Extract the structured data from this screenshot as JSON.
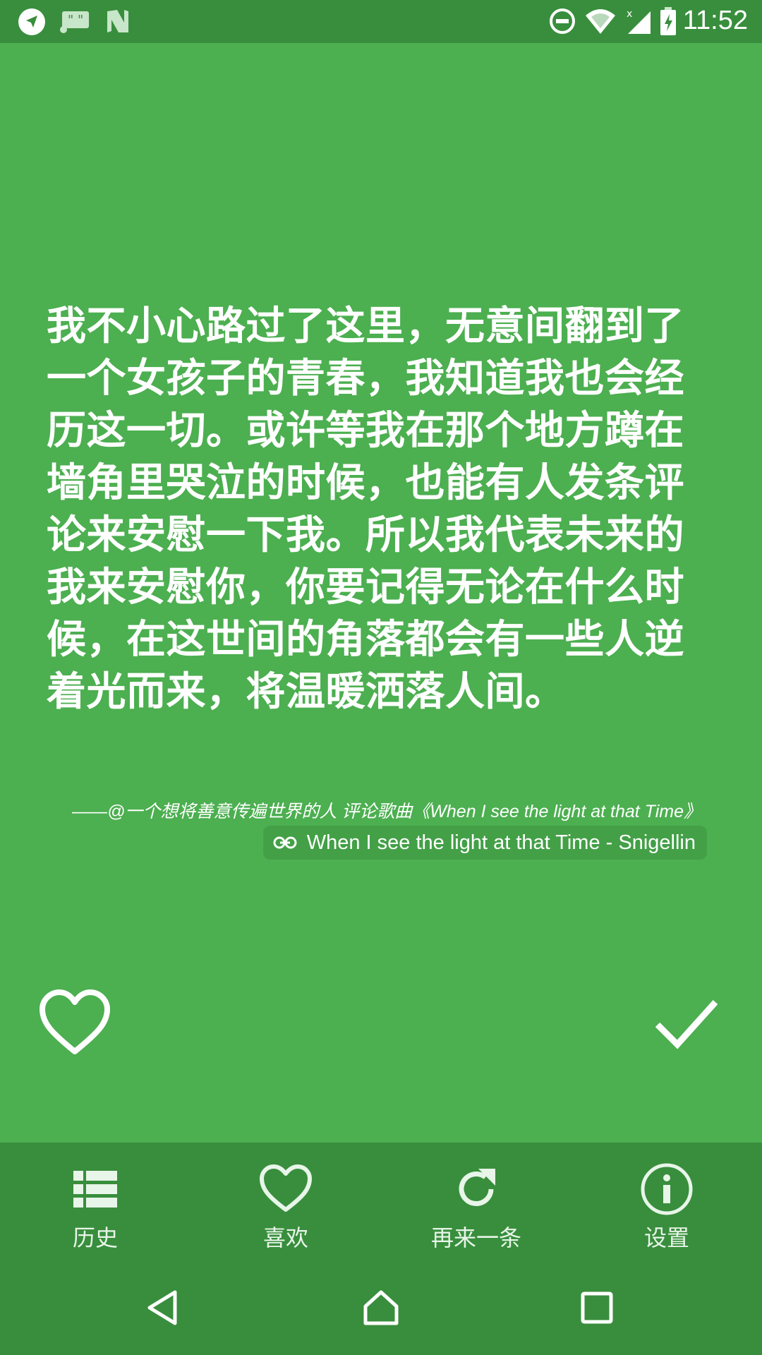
{
  "status_bar": {
    "time": "11:52",
    "left_icons": [
      "navigation-arrow-icon",
      "quote-keyboard-icon",
      "n-logo-icon"
    ],
    "right_icons": [
      "do-not-disturb-icon",
      "wifi-icon",
      "cellular-signal-icon",
      "battery-charging-icon"
    ]
  },
  "quote": {
    "text": "我不小心路过了这里，无意间翻到了一个女孩子的青春，我知道我也会经历这一切。或许等我在那个地方蹲在墙角里哭泣的时候，也能有人发条评论来安慰一下我。所以我代表未来的我来安慰你，你要记得无论在什么时候，在这世间的角落都会有一些人逆着光而来，将温暖洒落人间。",
    "attribution": "——@一个想将善意传遍世界的人 评论歌曲《When I see the light at that Time》",
    "song_link": "When I see the light at that Time - Snigellin"
  },
  "actions": {
    "like_icon": "heart-outline-icon",
    "confirm_icon": "checkmark-icon"
  },
  "bottom_nav": [
    {
      "label": "历史",
      "icon": "list-icon"
    },
    {
      "label": "喜欢",
      "icon": "heart-outline-icon"
    },
    {
      "label": "再来一条",
      "icon": "refresh-icon"
    },
    {
      "label": "设置",
      "icon": "info-icon"
    }
  ],
  "system_nav": [
    "back-icon",
    "home-icon",
    "recents-icon"
  ],
  "colors": {
    "primary": "#4caf50",
    "primary_dark": "#388e3c",
    "link_chip": "#43a047",
    "text": "#ffffff"
  }
}
